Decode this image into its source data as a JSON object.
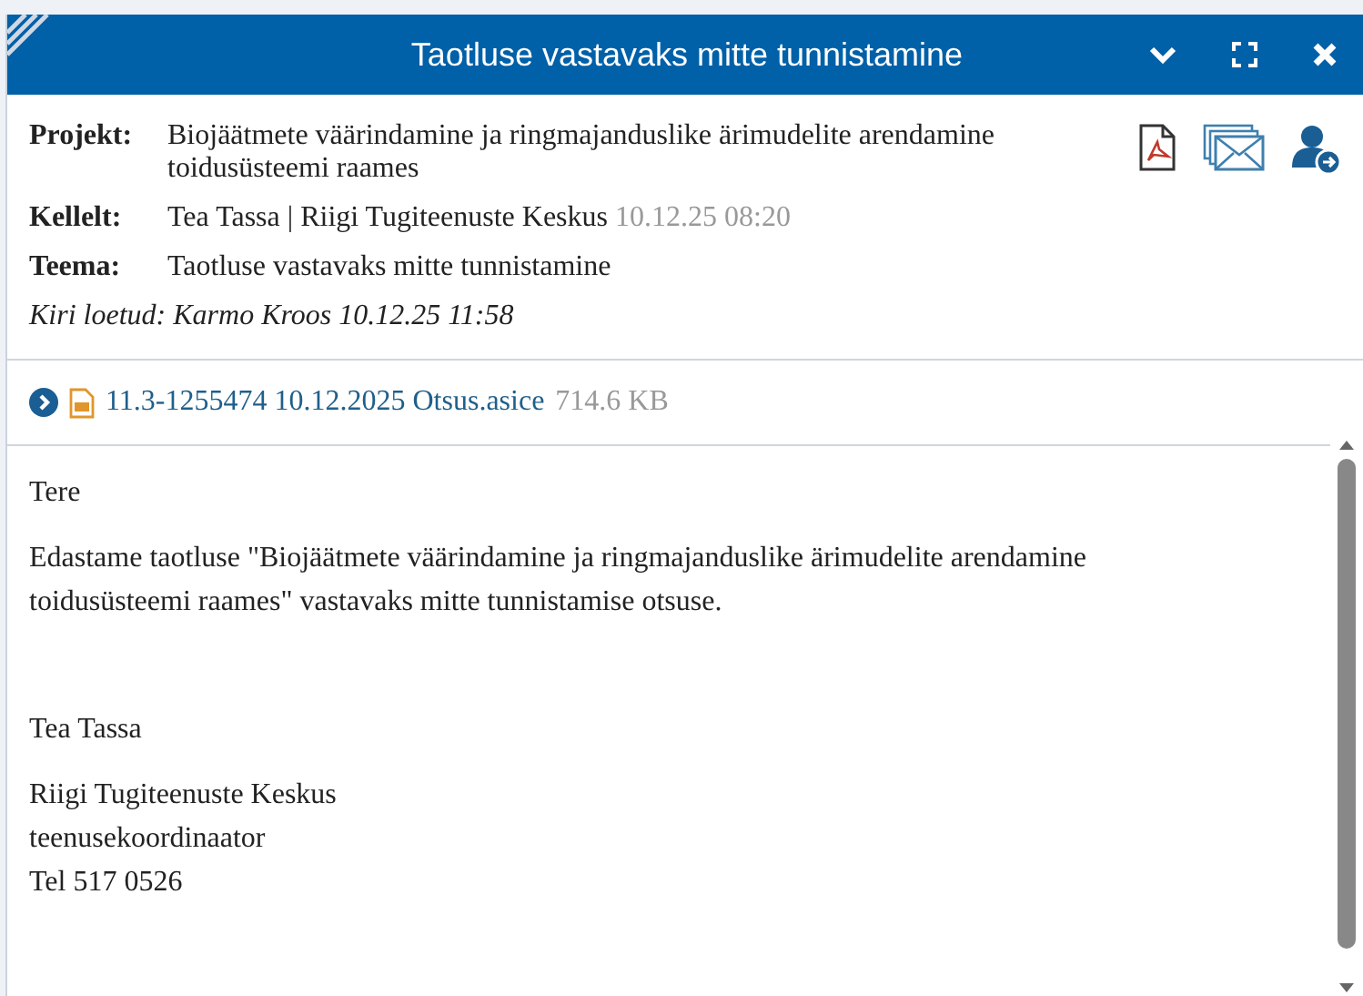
{
  "window": {
    "title": "Taotluse vastavaks mitte tunnistamine"
  },
  "header": {
    "fields": [
      {
        "label": "Projekt:",
        "value": "Biojäätmete väärindamine ja ringmajanduslike ärimudelite arendamine toidusüsteemi raames"
      },
      {
        "label": "Kellelt:",
        "value": "Tea Tassa | Riigi Tugiteenuste Keskus",
        "meta": "10.12.25 08:20"
      },
      {
        "label": "Teema:",
        "value": "Taotluse vastavaks mitte tunnistamine"
      }
    ],
    "read_note": "Kiri loetud: Karmo Kroos 10.12.25 11:58"
  },
  "attachment": {
    "name": "11.3-1255474 10.12.2025 Otsus.asice",
    "size": "714.6 KB"
  },
  "body": [
    {
      "lines": [
        "Tere"
      ]
    },
    {
      "lines": [
        "Edastame taotluse \"Biojäätmete väärindamine ja ringmajanduslike ärimudelite arendamine toidusüsteemi raames\" vastavaks mitte tunnistamise otsuse."
      ]
    },
    {
      "lines": [
        "Tea Tassa"
      ]
    },
    {
      "lines": [
        "Riigi Tugiteenuste Keskus",
        "teenusekoordinaator",
        "Tel 517 0526"
      ]
    }
  ]
}
